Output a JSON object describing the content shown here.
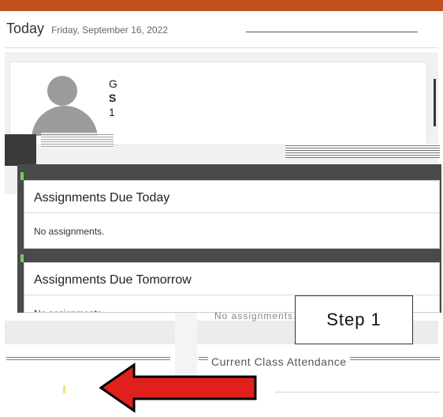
{
  "header": {
    "title": "Today",
    "date": "Friday, September 16, 2022"
  },
  "profile": {
    "name_initial": "G",
    "line2": "S",
    "line3": "1"
  },
  "cards": [
    {
      "title": "Assignments Due Today",
      "body": "No assignments."
    },
    {
      "title": "Assignments Due Tomorrow",
      "body": "No assignments."
    }
  ],
  "background_text": {
    "ghost_assignments": "No assignments.",
    "section_title": "Current Class Attendance"
  },
  "annotation": {
    "step_label": "Step 1",
    "arrow_color": "#e0201c"
  },
  "colors": {
    "topbar": "#c0501c",
    "accent_green": "#6fcf5a",
    "panel_dark": "#4a4a4a"
  }
}
